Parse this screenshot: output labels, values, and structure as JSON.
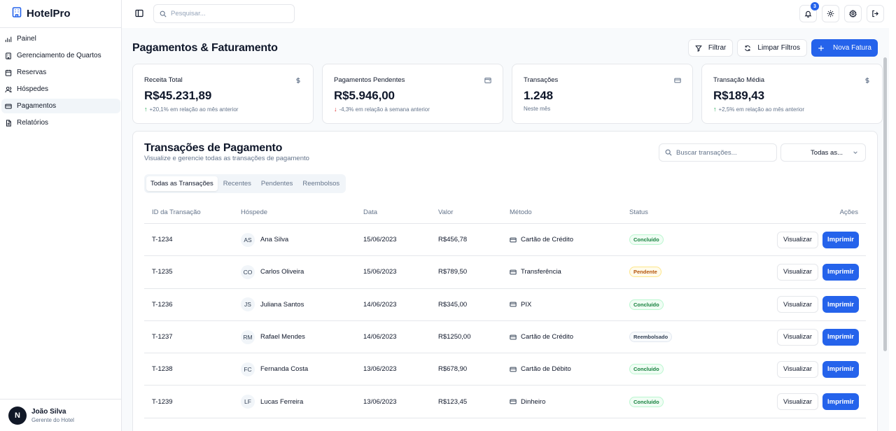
{
  "app": {
    "name": "HotelPro"
  },
  "sidebar": {
    "items": [
      {
        "label": "Painel",
        "icon": "dashboard-icon",
        "active": false
      },
      {
        "label": "Gerenciamento de Quartos",
        "icon": "building-icon",
        "active": false
      },
      {
        "label": "Reservas",
        "icon": "calendar-icon",
        "active": false
      },
      {
        "label": "Hóspedes",
        "icon": "users-icon",
        "active": false
      },
      {
        "label": "Pagamentos",
        "icon": "credit-card-icon",
        "active": true
      },
      {
        "label": "Relatórios",
        "icon": "report-icon",
        "active": false
      }
    ],
    "user": {
      "initial": "N",
      "name": "João Silva",
      "role": "Gerente do Hotel"
    }
  },
  "topbar": {
    "search_placeholder": "Pesquisar...",
    "notification_count": "3"
  },
  "header": {
    "title": "Pagamentos & Faturamento",
    "filter_label": "Filtrar",
    "clear_label": "Limpar Filtros",
    "new_invoice_label": "Nova Fatura"
  },
  "stats": [
    {
      "label": "Receita Total",
      "value": "R$45.231,89",
      "trend": "up",
      "note": "+20,1% em relação ao mês anterior",
      "icon": "dollar-icon"
    },
    {
      "label": "Pagamentos Pendentes",
      "value": "R$5.946,00",
      "trend": "down",
      "note": "-4,3% em relação à semana anterior",
      "icon": "wallet-icon"
    },
    {
      "label": "Transações",
      "value": "1.248",
      "trend": "none",
      "note": "Neste mês",
      "icon": "credit-card-icon"
    },
    {
      "label": "Transação Média",
      "value": "R$189,43",
      "trend": "up",
      "note": "+2,5% em relação ao mês anterior",
      "icon": "dollar-icon"
    }
  ],
  "panel": {
    "title": "Transações de Pagamento",
    "subtitle": "Visualize e gerencie todas as transações de pagamento",
    "search_placeholder": "Buscar transações...",
    "select_value": "Todas as...",
    "tabs": [
      "Todas as Transações",
      "Recentes",
      "Pendentes",
      "Reembolsos"
    ],
    "columns": [
      "ID da Transação",
      "Hóspede",
      "Data",
      "Valor",
      "Método",
      "Status",
      "Ações"
    ],
    "view_label": "Visualizar",
    "print_label": "Imprimir",
    "rows": [
      {
        "id": "T-1234",
        "initials": "AS",
        "guest": "Ana Silva",
        "date": "15/06/2023",
        "value": "R$456,78",
        "method": "Cartão de Crédito",
        "status": "Concluído",
        "status_kind": "ok"
      },
      {
        "id": "T-1235",
        "initials": "CO",
        "guest": "Carlos Oliveira",
        "date": "15/06/2023",
        "value": "R$789,50",
        "method": "Transferência",
        "status": "Pendente",
        "status_kind": "pend"
      },
      {
        "id": "T-1236",
        "initials": "JS",
        "guest": "Juliana Santos",
        "date": "14/06/2023",
        "value": "R$345,00",
        "method": "PIX",
        "status": "Concluído",
        "status_kind": "ok"
      },
      {
        "id": "T-1237",
        "initials": "RM",
        "guest": "Rafael Mendes",
        "date": "14/06/2023",
        "value": "R$1250,00",
        "method": "Cartão de Crédito",
        "status": "Reembolsado",
        "status_kind": "ref"
      },
      {
        "id": "T-1238",
        "initials": "FC",
        "guest": "Fernanda Costa",
        "date": "13/06/2023",
        "value": "R$678,90",
        "method": "Cartão de Débito",
        "status": "Concluído",
        "status_kind": "ok"
      },
      {
        "id": "T-1239",
        "initials": "LF",
        "guest": "Lucas Ferreira",
        "date": "13/06/2023",
        "value": "R$123,45",
        "method": "Dinheiro",
        "status": "Concluído",
        "status_kind": "ok"
      }
    ]
  },
  "colors": {
    "primary": "#2563eb",
    "success": "#16a34a",
    "danger": "#dc2626",
    "border": "#e5e7eb",
    "muted": "#64748b"
  }
}
